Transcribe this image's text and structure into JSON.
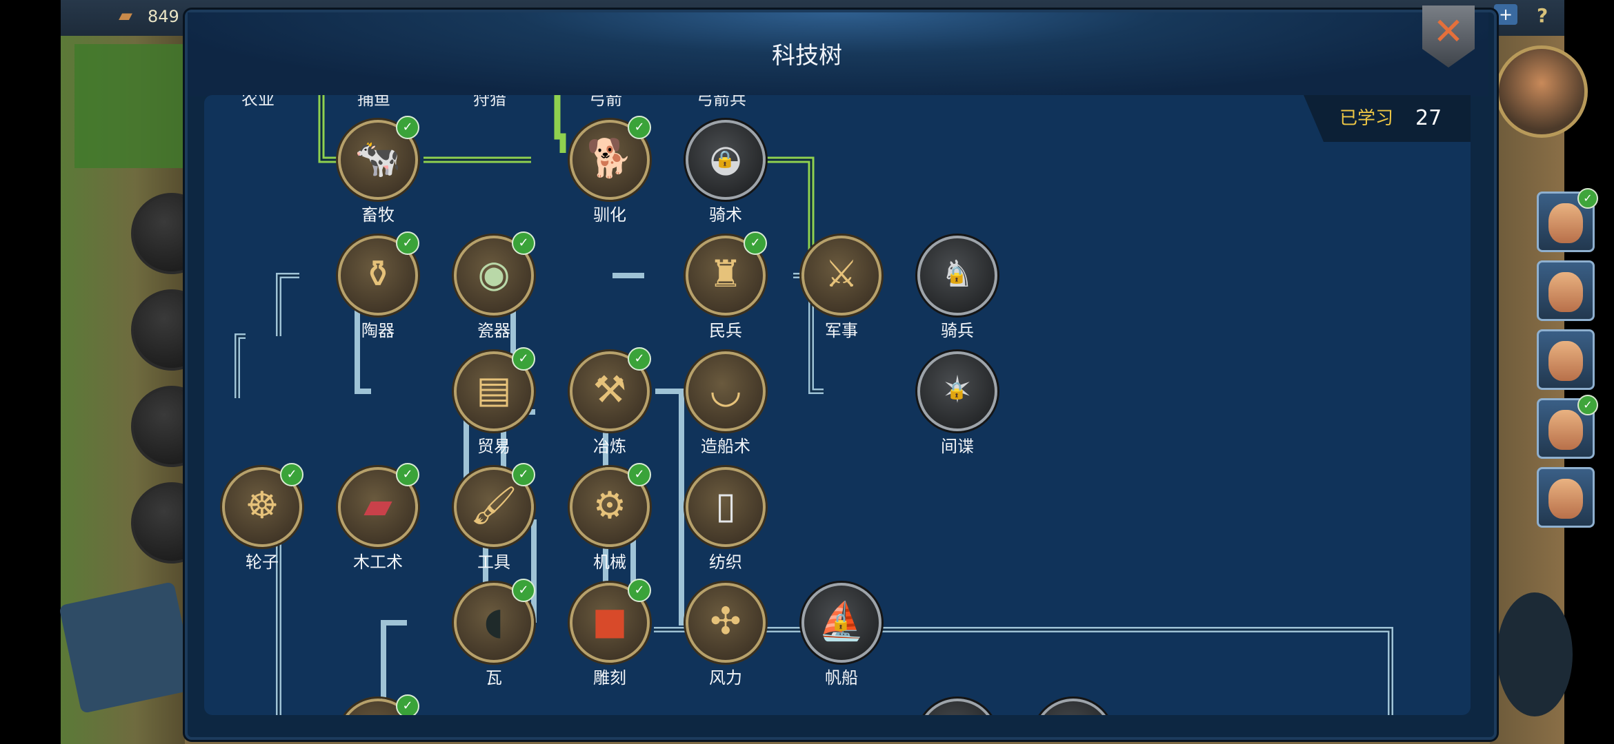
{
  "game": {
    "resource_value": "849"
  },
  "modal": {
    "title": "科技树",
    "close_label": "✕",
    "learned_label": "已学习",
    "learned_count": "27"
  },
  "top_labels": [
    "农业",
    "捕鱼",
    "狩猎",
    "弓箭",
    "弓箭兵"
  ],
  "nodes": {
    "animal_husbandry": "畜牧",
    "domestication": "驯化",
    "horseback": "骑术",
    "pottery": "陶器",
    "porcelain": "瓷器",
    "militia": "民兵",
    "military": "军事",
    "cavalry": "骑兵",
    "trade": "贸易",
    "smelting": "冶炼",
    "shipbuilding": "造船术",
    "espionage": "间谍",
    "wheel": "轮子",
    "carpentry": "木工术",
    "tools": "工具",
    "machinery": "机械",
    "weaving": "纺织",
    "tiles": "瓦",
    "carving": "雕刻",
    "wind_power": "风力",
    "sailing": "帆船"
  },
  "node_states": {
    "learned": [
      "animal_husbandry",
      "domestication",
      "pottery",
      "porcelain",
      "militia",
      "trade",
      "smelting",
      "wheel",
      "carpentry",
      "tools",
      "machinery",
      "tiles",
      "carving"
    ],
    "locked": [
      "horseback",
      "cavalry",
      "espionage",
      "sailing"
    ]
  },
  "colors": {
    "panel_bg": "#10335a",
    "modal_bg": "#0d2742",
    "path_green": "#8fd14f",
    "path_blue": "#9fc3d6",
    "learned_label": "#f0c845",
    "check_green": "#3aa339"
  }
}
